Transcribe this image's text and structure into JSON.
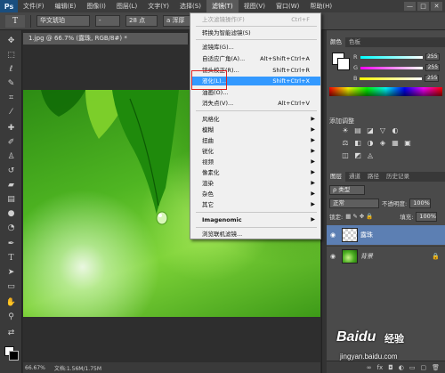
{
  "app": {
    "logo": "Ps"
  },
  "menubar": {
    "items": [
      "文件(F)",
      "编辑(E)",
      "图像(I)",
      "图层(L)",
      "文字(Y)",
      "选择(S)",
      "滤镜(T)",
      "视图(V)",
      "窗口(W)",
      "帮助(H)"
    ],
    "active_index": 6,
    "window_controls": [
      "—",
      "□",
      "✕"
    ]
  },
  "options_bar": {
    "tool_glyph": "T",
    "font_family": "华文琥珀",
    "font_style": "-",
    "font_size": "28 点",
    "anti_alias": "a  浑厚"
  },
  "document": {
    "tab_title": "1.jpg @ 66.7% (露珠, RGB/8#) *",
    "zoom": "66.67%",
    "doc_info": "文档:1.56M/1.75M"
  },
  "filter_menu": {
    "items": [
      {
        "label": "上次滤镜操作(F)",
        "shortcut": "Ctrl+F",
        "disabled": true
      },
      {
        "sep": true
      },
      {
        "label": "转换为智能滤镜(S)"
      },
      {
        "sep": true
      },
      {
        "label": "滤镜库(G)..."
      },
      {
        "label": "自适应广角(A)...",
        "shortcut": "Alt+Shift+Ctrl+A"
      },
      {
        "label": "镜头校正(R)...",
        "shortcut": "Shift+Ctrl+R"
      },
      {
        "label": "液化(L)...",
        "shortcut": "Shift+Ctrl+X",
        "highlight": true
      },
      {
        "label": "油画(O)..."
      },
      {
        "label": "消失点(V)...",
        "shortcut": "Alt+Ctrl+V"
      },
      {
        "sep": true
      },
      {
        "label": "风格化",
        "submenu": true
      },
      {
        "label": "模糊",
        "submenu": true
      },
      {
        "label": "扭曲",
        "submenu": true
      },
      {
        "label": "锐化",
        "submenu": true
      },
      {
        "label": "视频",
        "submenu": true
      },
      {
        "label": "像素化",
        "submenu": true
      },
      {
        "label": "渲染",
        "submenu": true
      },
      {
        "label": "杂色",
        "submenu": true
      },
      {
        "label": "其它",
        "submenu": true
      },
      {
        "sep": true
      },
      {
        "label": "Imagenomic",
        "submenu": true,
        "bold": true
      },
      {
        "sep": true
      },
      {
        "label": "浏览联机滤镜..."
      }
    ]
  },
  "color_panel": {
    "tabs": [
      "颜色",
      "色板"
    ],
    "channels": [
      {
        "label": "R",
        "value": "255",
        "color": "#ff4040"
      },
      {
        "label": "G",
        "value": "255",
        "color": "#40ff40"
      },
      {
        "label": "B",
        "value": "255",
        "color": "#ffff40"
      }
    ]
  },
  "adjustments_panel": {
    "title": "添加调整",
    "icons": [
      "☀",
      "▤",
      "◪",
      "▽",
      "◐",
      "⚖",
      "◧",
      "◑",
      "◈",
      "▦",
      "▣",
      "◫",
      "◩",
      "◬"
    ]
  },
  "layers_panel": {
    "tabs": [
      "图层",
      "通道",
      "路径",
      "历史记录"
    ],
    "filter_label": "ρ 类型",
    "blend_mode": "正常",
    "opacity_label": "不透明度:",
    "opacity_value": "100%",
    "lock_label": "锁定:",
    "fill_label": "填充:",
    "fill_value": "100%",
    "layers": [
      {
        "name": "露珠",
        "active": true,
        "thumb": "transparent"
      },
      {
        "name": "背景",
        "active": false,
        "thumb": "image",
        "locked": true
      }
    ],
    "footer_icons": [
      "∞",
      "fx",
      "◘",
      "◐",
      "▭",
      "▢",
      "🗑"
    ]
  },
  "watermark": {
    "logo": "Baidu",
    "cn": "经验",
    "url": "jingyan.baidu.com"
  }
}
